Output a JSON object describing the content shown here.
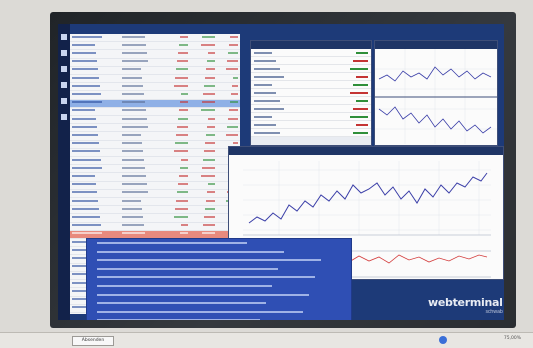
{
  "brand": {
    "name": "webterminal",
    "sub": "schwab"
  },
  "taskbar": {
    "button_label": "Absenden",
    "zoom": "75,00%"
  },
  "watchlist_rows": 38,
  "news_rows": 11,
  "colors": {
    "screen_bg": "#1d3a78",
    "news_bg": "#2f4fb4",
    "price_line": "#3b3fa8",
    "indicator_line": "#d33b3b"
  }
}
